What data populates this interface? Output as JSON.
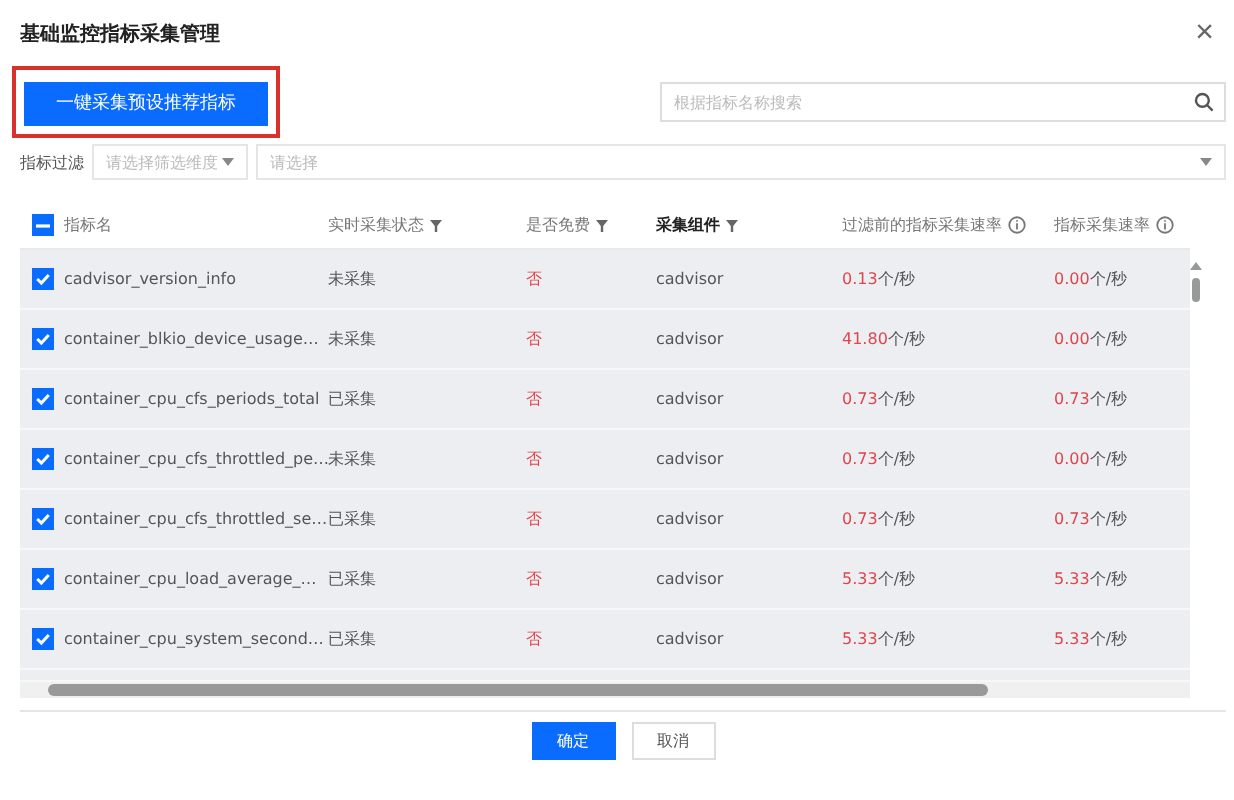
{
  "dialog": {
    "title": "基础监控指标采集管理",
    "close": "×"
  },
  "toolbar": {
    "primary_button": "一键采集预设推荐指标",
    "highlighted": true,
    "search": {
      "placeholder": "根据指标名称搜索"
    }
  },
  "filter": {
    "label": "指标过滤",
    "dimension": {
      "placeholder": "请选择筛选维度"
    },
    "value": {
      "placeholder": "请选择"
    }
  },
  "table": {
    "select_all_partial": true,
    "columns": [
      {
        "label": "指标名",
        "filter": false,
        "info": false,
        "bold": false
      },
      {
        "label": "实时采集状态",
        "filter": true,
        "info": false,
        "bold": false
      },
      {
        "label": "是否免费",
        "filter": true,
        "info": false,
        "bold": false
      },
      {
        "label": "采集组件",
        "filter": true,
        "info": false,
        "bold": true
      },
      {
        "label": "过滤前的指标采集速率",
        "filter": false,
        "info": true,
        "bold": false
      },
      {
        "label": "指标采集速率",
        "filter": false,
        "info": true,
        "bold": false
      }
    ],
    "rows": [
      {
        "checked": true,
        "name": "cadvisor_version_info",
        "status": "未采集",
        "free": "否",
        "component": "cadvisor",
        "rate_before": {
          "value": "0.13",
          "unit": "个/秒"
        },
        "rate": {
          "value": "0.00",
          "unit": "个/秒"
        }
      },
      {
        "checked": true,
        "name": "container_blkio_device_usage…",
        "status": "未采集",
        "free": "否",
        "component": "cadvisor",
        "rate_before": {
          "value": "41.80",
          "unit": "个/秒"
        },
        "rate": {
          "value": "0.00",
          "unit": "个/秒"
        }
      },
      {
        "checked": true,
        "name": "container_cpu_cfs_periods_total",
        "status": "已采集",
        "free": "否",
        "component": "cadvisor",
        "rate_before": {
          "value": "0.73",
          "unit": "个/秒"
        },
        "rate": {
          "value": "0.73",
          "unit": "个/秒"
        }
      },
      {
        "checked": true,
        "name": "container_cpu_cfs_throttled_pe…",
        "status": "未采集",
        "free": "否",
        "component": "cadvisor",
        "rate_before": {
          "value": "0.73",
          "unit": "个/秒"
        },
        "rate": {
          "value": "0.00",
          "unit": "个/秒"
        }
      },
      {
        "checked": true,
        "name": "container_cpu_cfs_throttled_se…",
        "status": "已采集",
        "free": "否",
        "component": "cadvisor",
        "rate_before": {
          "value": "0.73",
          "unit": "个/秒"
        },
        "rate": {
          "value": "0.73",
          "unit": "个/秒"
        }
      },
      {
        "checked": true,
        "name": "container_cpu_load_average_…",
        "status": "已采集",
        "free": "否",
        "component": "cadvisor",
        "rate_before": {
          "value": "5.33",
          "unit": "个/秒"
        },
        "rate": {
          "value": "5.33",
          "unit": "个/秒"
        }
      },
      {
        "checked": true,
        "name": "container_cpu_system_second…",
        "status": "已采集",
        "free": "否",
        "component": "cadvisor",
        "rate_before": {
          "value": "5.33",
          "unit": "个/秒"
        },
        "rate": {
          "value": "5.33",
          "unit": "个/秒"
        }
      }
    ]
  },
  "footer": {
    "confirm": "确定",
    "cancel": "取消"
  }
}
